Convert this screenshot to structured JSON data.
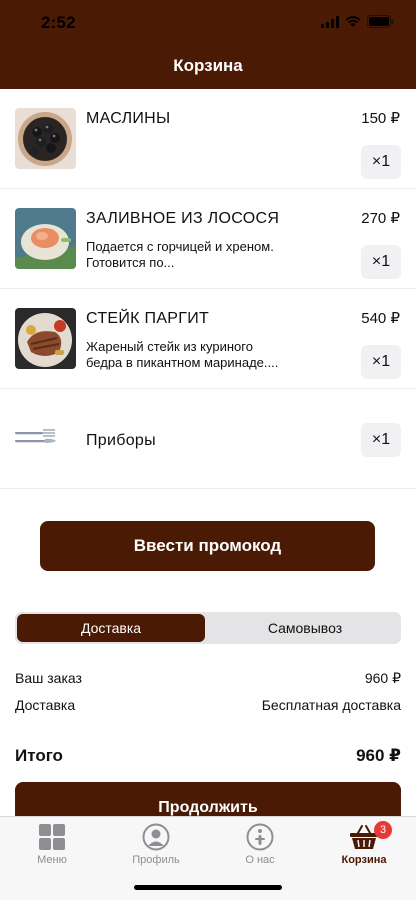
{
  "status_bar": {
    "time": "2:52"
  },
  "header": {
    "title": "Корзина"
  },
  "cart": {
    "items": [
      {
        "name": "МАСЛИНЫ",
        "description": "",
        "price": "150 ₽",
        "quantity": "×1"
      },
      {
        "name": "ЗАЛИВНОЕ ИЗ ЛОСОСЯ",
        "description": "Подается с горчицей и хреном. Готовится по...",
        "price": "270 ₽",
        "quantity": "×1"
      },
      {
        "name": "СТЕЙК ПАРГИТ",
        "description": "Жареный стейк из куриного бедра в пикантном маринаде....",
        "price": "540 ₽",
        "quantity": "×1"
      }
    ],
    "cutlery": {
      "name": "Приборы",
      "quantity": "×1"
    }
  },
  "promo": {
    "label": "Ввести промокод"
  },
  "delivery_toggle": {
    "options": [
      "Доставка",
      "Самовывоз"
    ],
    "selected": "Доставка"
  },
  "summary": {
    "order_label": "Ваш заказ",
    "order_value": "960 ₽",
    "delivery_label": "Доставка",
    "delivery_value": "Бесплатная доставка",
    "total_label": "Итого",
    "total_value": "960 ₽"
  },
  "continue": {
    "label": "Продолжить"
  },
  "tab_bar": {
    "tabs": [
      {
        "label": "Меню",
        "icon": "grid-icon"
      },
      {
        "label": "Профиль",
        "icon": "profile-icon"
      },
      {
        "label": "О нас",
        "icon": "info-icon"
      },
      {
        "label": "Корзина",
        "icon": "basket-icon",
        "badge": "3"
      }
    ],
    "active": "Корзина"
  },
  "colors": {
    "brand": "#4a1a04",
    "badge": "#e53935",
    "inactive_tab": "#8e8e93"
  }
}
